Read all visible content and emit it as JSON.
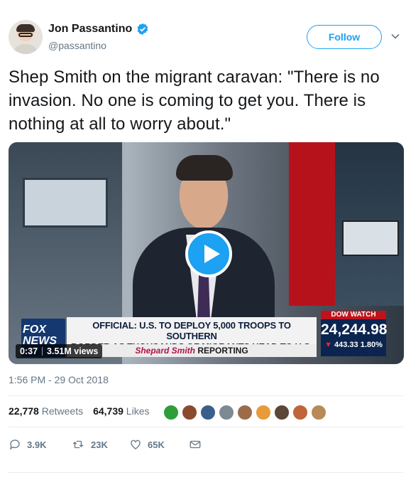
{
  "author": {
    "display_name": "Jon Passantino",
    "handle": "@passantino",
    "verified": true
  },
  "follow_label": "Follow",
  "tweet_text": "Shep Smith on the migrant caravan: \"There is no invasion. No one is coming to get you. There is nothing at all to worry about.\"",
  "video": {
    "channel_logo": "FOX NEWS",
    "banner_line1": "OFFICIAL: U.S. TO DEPLOY 5,000 TROOPS TO SOUTHERN",
    "banner_line2": "BORDER AS THOUSANDS OF MIGRANTS HEAD TO U.S.",
    "show_name": "Shepard Smith",
    "show_suffix": "REPORTING",
    "dow_label": "DOW WATCH",
    "dow_value": "24,244.98",
    "dow_change": "443.33",
    "dow_percent": "1.80%",
    "duration": "0:37",
    "views": "3.51M views"
  },
  "timestamp": "1:56 PM - 29 Oct 2018",
  "stats": {
    "retweets_count": "22,778",
    "retweets_label": "Retweets",
    "likes_count": "64,739",
    "likes_label": "Likes"
  },
  "actions": {
    "replies": "3.9K",
    "retweets": "23K",
    "likes": "65K"
  },
  "colors": {
    "accent": "#1da1f2",
    "text": "#14171a",
    "muted": "#657786",
    "divider": "#e6ecf0"
  },
  "liker_avatar_colors": [
    "#2e9e3a",
    "#8a4b2d",
    "#3a5f8c",
    "#7d8a94",
    "#9c6b4a",
    "#e79b3a",
    "#5b4638",
    "#c0643a",
    "#b88a5a"
  ]
}
